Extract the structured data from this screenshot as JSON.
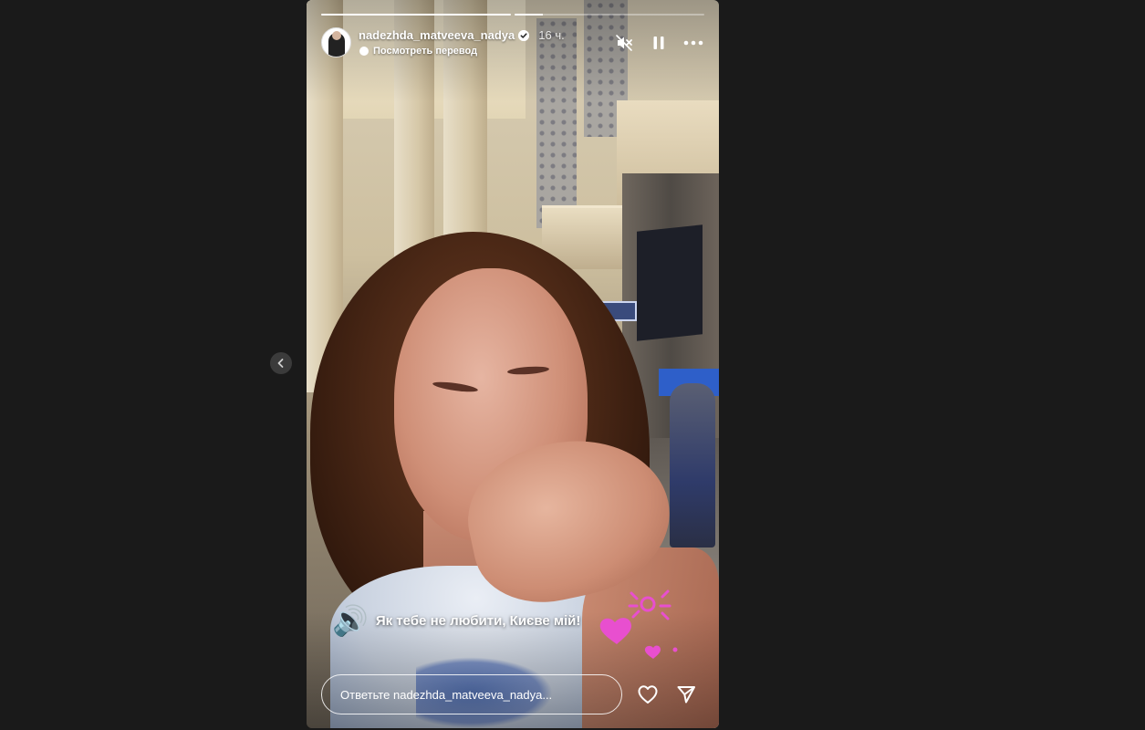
{
  "story": {
    "progress": [
      1.0,
      0.15
    ],
    "user": {
      "username": "nadezhda_matveeva_nadya",
      "verified": true,
      "time": "16 ч."
    },
    "translate_label": "Посмотреть перевод",
    "caption": "Як тебе не любити, Києве мій!",
    "reply_placeholder": "Ответьте nadezhda_matveeva_nadya..."
  },
  "icons": {
    "prev": "chevron-left-icon",
    "mute": "speaker-muted-icon",
    "pause": "pause-icon",
    "more": "more-horizontal-icon",
    "translate": "translate-icon",
    "like": "heart-icon",
    "share": "send-icon"
  },
  "colors": {
    "page_bg": "#1a1a1a",
    "sticker_pink": "#e84fcf",
    "verified_blue": "#3897f0"
  }
}
